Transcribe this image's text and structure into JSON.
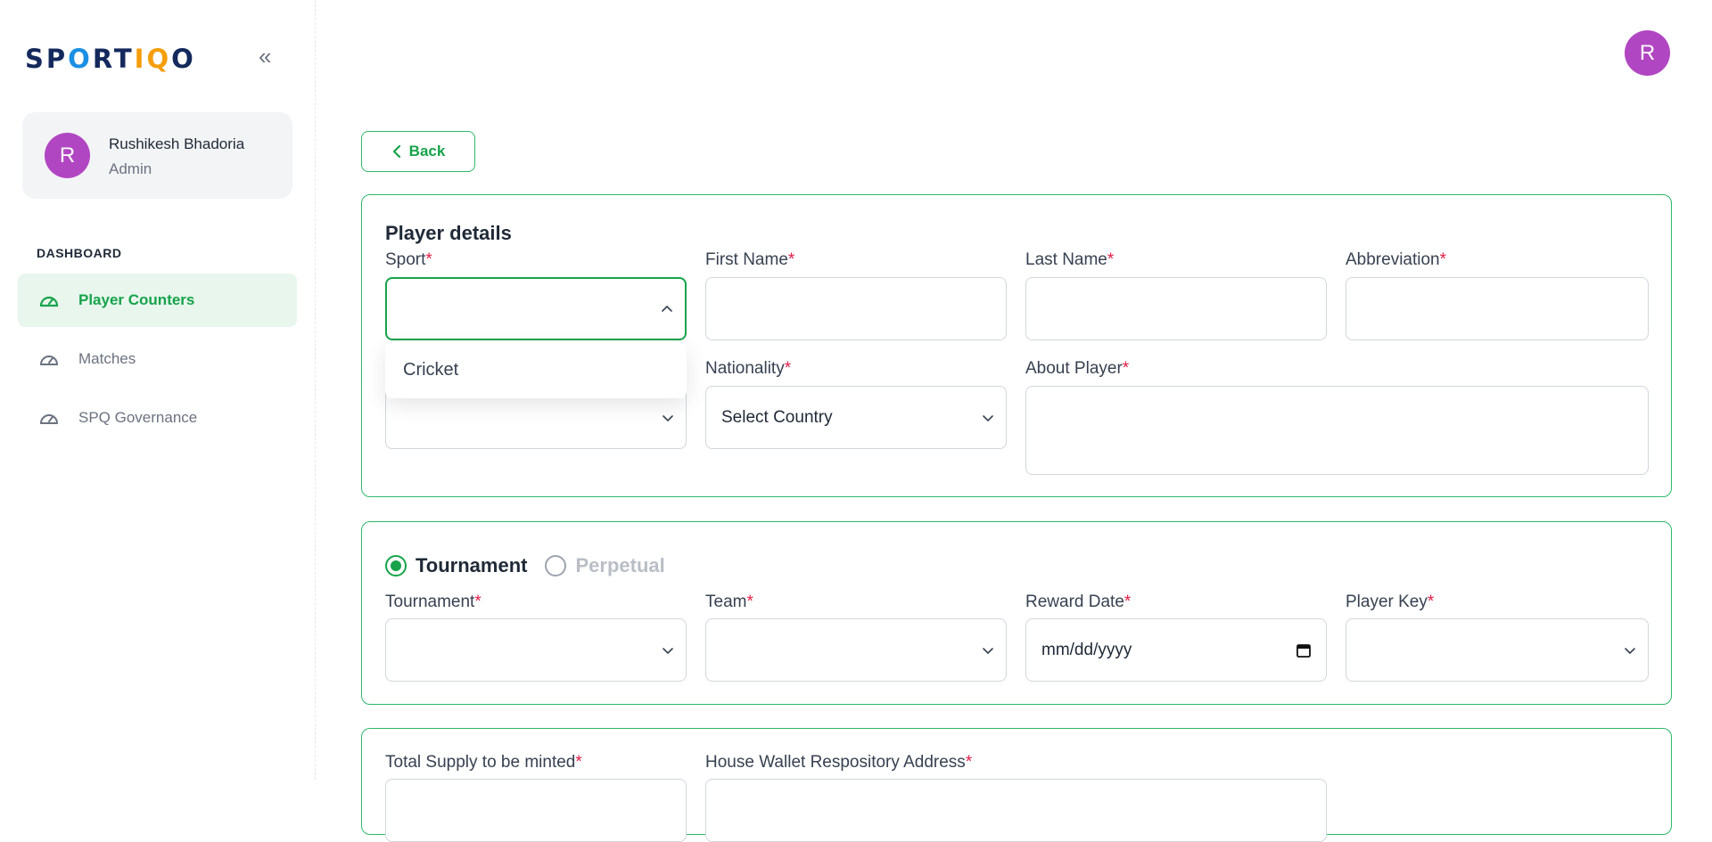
{
  "brand": {
    "logo_text": "SPORTIQO",
    "colors": {
      "primary": "#16a34a",
      "navy": "#14295c",
      "accent_orange": "#f59e0b",
      "avatar": "#b146c2"
    }
  },
  "sidebar": {
    "user": {
      "initial": "R",
      "name": "Rushikesh Bhadoria",
      "role": "Admin"
    },
    "section_label": "DASHBOARD",
    "items": [
      {
        "label": "Player Counters",
        "icon": "speedometer-icon",
        "active": true
      },
      {
        "label": "Matches",
        "icon": "speedometer-icon",
        "active": false
      },
      {
        "label": "SPQ Governance",
        "icon": "speedometer-icon",
        "active": false
      }
    ]
  },
  "header": {
    "avatar_initial": "R"
  },
  "back_label": "Back",
  "player_details": {
    "title": "Player details",
    "sport": {
      "label": "Sport",
      "value": "",
      "options": [
        "Cricket"
      ]
    },
    "first_name": {
      "label": "First Name",
      "value": ""
    },
    "last_name": {
      "label": "Last Name",
      "value": ""
    },
    "abbreviation": {
      "label": "Abbreviation",
      "value": ""
    },
    "nationality": {
      "label": "Nationality",
      "value": "Select Country"
    },
    "about_player": {
      "label": "About Player",
      "value": ""
    }
  },
  "reward": {
    "mode_options": [
      "Tournament",
      "Perpetual"
    ],
    "selected_mode": "Tournament",
    "tournament": {
      "label": "Tournament",
      "value": ""
    },
    "team": {
      "label": "Team",
      "value": ""
    },
    "reward_date": {
      "label": "Reward Date",
      "placeholder": "mm/dd/yyyy"
    },
    "player_key": {
      "label": "Player Key",
      "value": ""
    }
  },
  "supply": {
    "total_supply": {
      "label": "Total Supply to be minted"
    },
    "house_wallet": {
      "label": "House Wallet Respository Address"
    }
  },
  "required_marker": "*"
}
